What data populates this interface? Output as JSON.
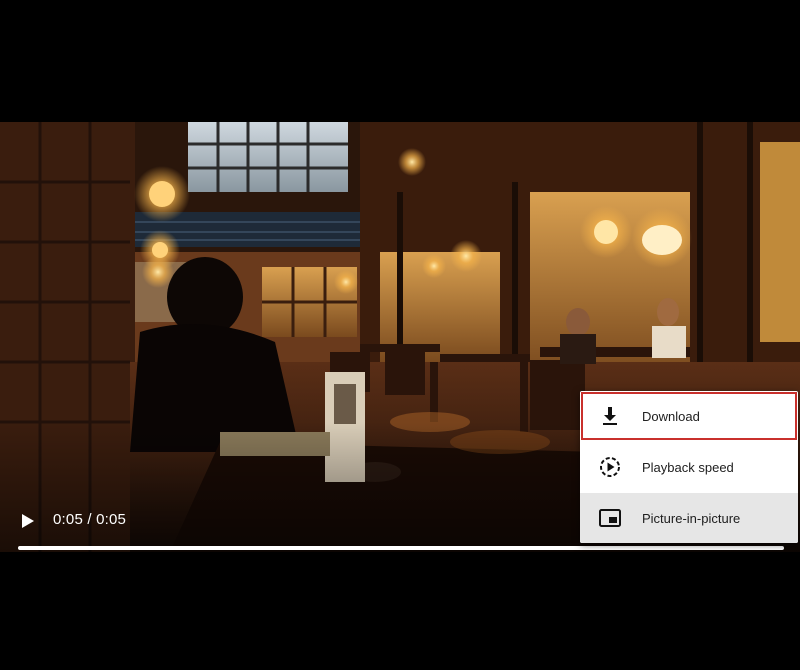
{
  "player": {
    "time_text": "0:05 / 0:05",
    "progress": 1.0
  },
  "context_menu": {
    "items": [
      {
        "label": "Download",
        "icon": "download-icon",
        "state": "focused"
      },
      {
        "label": "Playback speed",
        "icon": "playback-speed-icon",
        "state": "normal"
      },
      {
        "label": "Picture-in-picture",
        "icon": "picture-in-picture-icon",
        "state": "hovered"
      }
    ]
  },
  "colors": {
    "focus_outline": "#c9302c",
    "hover_bg": "#e6e6e6",
    "menu_text": "#202020"
  }
}
